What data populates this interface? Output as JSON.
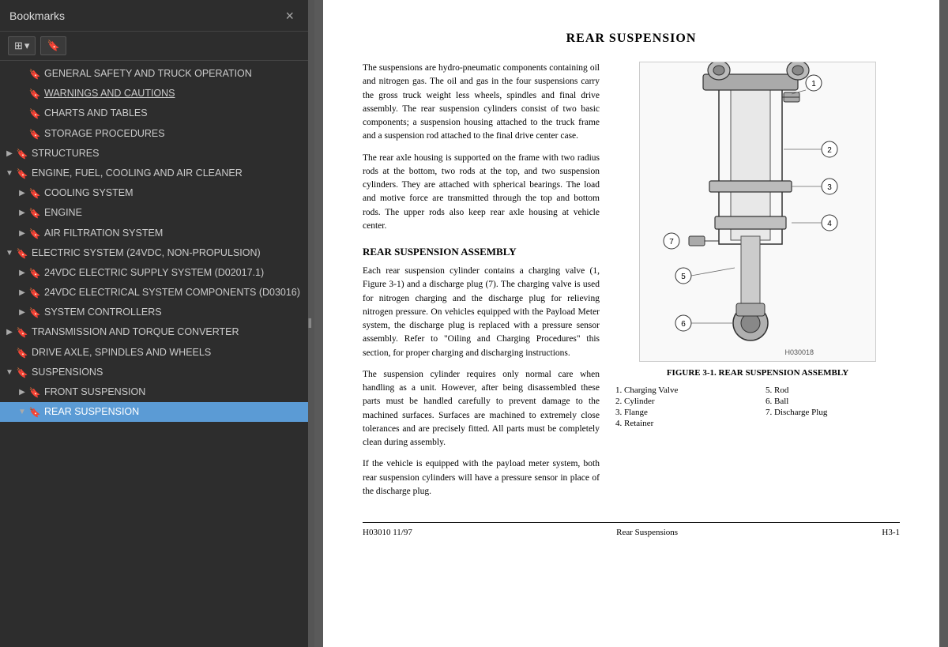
{
  "sidebar": {
    "title": "Bookmarks",
    "close_label": "×",
    "toolbar": {
      "view_btn": "≡ ▾",
      "bookmark_btn": "🔖"
    },
    "items": [
      {
        "id": "general-safety",
        "label": "GENERAL SAFETY AND TRUCK OPERATION",
        "level": 1,
        "expanded": false,
        "arrow": "",
        "underline": false
      },
      {
        "id": "warnings-cautions",
        "label": "WARNINGS AND CAUTIONS",
        "level": 1,
        "expanded": false,
        "arrow": "",
        "underline": true
      },
      {
        "id": "charts-tables",
        "label": "CHARTS AND TABLES",
        "level": 1,
        "expanded": false,
        "arrow": "",
        "underline": false
      },
      {
        "id": "storage-procedures",
        "label": "STORAGE PROCEDURES",
        "level": 1,
        "expanded": false,
        "arrow": "",
        "underline": false
      },
      {
        "id": "structures",
        "label": "STRUCTURES",
        "level": 0,
        "expanded": false,
        "arrow": "▶",
        "underline": false
      },
      {
        "id": "engine-fuel",
        "label": "ENGINE, FUEL, COOLING AND AIR CLEANER",
        "level": 0,
        "expanded": true,
        "arrow": "▼",
        "underline": false
      },
      {
        "id": "cooling-system",
        "label": "COOLING SYSTEM",
        "level": 1,
        "expanded": false,
        "arrow": "▶",
        "underline": false
      },
      {
        "id": "engine",
        "label": "ENGINE",
        "level": 1,
        "expanded": false,
        "arrow": "▶",
        "underline": false
      },
      {
        "id": "air-filtration",
        "label": "AIR FILTRATION SYSTEM",
        "level": 1,
        "expanded": false,
        "arrow": "▶",
        "underline": false
      },
      {
        "id": "electric-system",
        "label": "ELECTRIC SYSTEM (24VDC, NON-PROPULSION)",
        "level": 0,
        "expanded": true,
        "arrow": "▼",
        "underline": false
      },
      {
        "id": "24vdc-supply",
        "label": "24VDC ELECTRIC SUPPLY SYSTEM (D02017.1)",
        "level": 1,
        "expanded": false,
        "arrow": "▶",
        "underline": false
      },
      {
        "id": "24vdc-components",
        "label": "24VDC ELECTRICAL SYSTEM COMPONENTS (D03016)",
        "level": 1,
        "expanded": false,
        "arrow": "▶",
        "underline": false
      },
      {
        "id": "system-controllers",
        "label": "SYSTEM CONTROLLERS",
        "level": 1,
        "expanded": false,
        "arrow": "▶",
        "underline": false
      },
      {
        "id": "transmission",
        "label": "TRANSMISSION AND TORQUE CONVERTER",
        "level": 0,
        "expanded": false,
        "arrow": "▶",
        "underline": false
      },
      {
        "id": "drive-axle",
        "label": "DRIVE AXLE, SPINDLES AND WHEELS",
        "level": 0,
        "expanded": false,
        "arrow": "",
        "underline": false
      },
      {
        "id": "suspensions",
        "label": "SUSPENSIONS",
        "level": 0,
        "expanded": true,
        "arrow": "▼",
        "underline": false
      },
      {
        "id": "front-suspension",
        "label": "FRONT SUSPENSION",
        "level": 1,
        "expanded": false,
        "arrow": "▶",
        "underline": false
      },
      {
        "id": "rear-suspension",
        "label": "REAR SUSPENSION",
        "level": 1,
        "expanded": true,
        "arrow": "▼",
        "underline": false,
        "active": true
      }
    ]
  },
  "main": {
    "page_title": "REAR SUSPENSION",
    "intro_paragraphs": [
      "The suspensions are hydro-pneumatic components containing oil and nitrogen gas. The oil and gas in the four suspensions carry the gross truck weight less wheels, spindles and final drive assembly. The rear suspension cylinders consist of two basic components; a suspension housing attached to the truck frame and a suspension rod attached to the final drive center case.",
      "The rear axle housing is supported on the frame with two radius rods at the bottom, two rods at the top, and two suspension cylinders.  They are attached with spherical bearings.  The load and motive force are transmitted through the top and bottom rods. The upper rods also keep rear axle housing at vehicle center."
    ],
    "assembly_heading": "REAR SUSPENSION ASSEMBLY",
    "assembly_paragraphs": [
      "Each rear suspension cylinder contains a charging valve (1, Figure 3-1) and a discharge plug (7). The charging valve is used for nitrogen charging and the discharge plug for relieving nitrogen pressure. On vehicles equipped with the Payload Meter system, the discharge plug is replaced with a pressure sensor assembly. Refer to \"Oiling and Charging Procedures\" this section, for proper charging and discharging instructions.",
      "The suspension cylinder requires only normal care when handling as a unit. However, after being disassembled these parts must be handled carefully to prevent damage to the machined surfaces. Surfaces are machined to extremely close tolerances and are precisely fitted. All parts must be completely clean during assembly.",
      "If the vehicle is equipped with the payload meter system, both rear suspension cylinders will have a pressure sensor in place of the discharge plug."
    ],
    "figure_caption": "FIGURE 3-1. REAR SUSPENSION ASSEMBLY",
    "figure_id": "H030018",
    "parts": [
      {
        "num": "1.",
        "name": "Charging Valve"
      },
      {
        "num": "2.",
        "name": "Cylinder"
      },
      {
        "num": "3.",
        "name": "Flange"
      },
      {
        "num": "4.",
        "name": "Retainer"
      },
      {
        "num": "5.",
        "name": "Rod"
      },
      {
        "num": "6.",
        "name": "Ball"
      },
      {
        "num": "7.",
        "name": "Discharge Plug"
      }
    ],
    "footer": {
      "left": "H03010 11/97",
      "center": "Rear Suspensions",
      "right": "H3-1"
    }
  }
}
